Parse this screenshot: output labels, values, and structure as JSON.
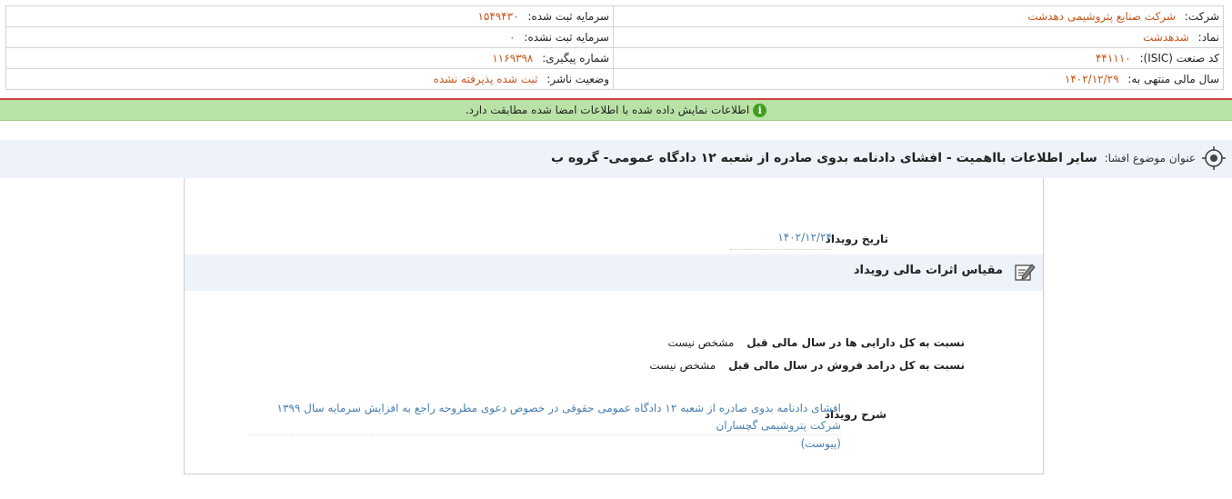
{
  "company_info": {
    "company_label": "شرکت:",
    "company_value": "شرکت صنایع پتروشیمی دهدشت",
    "registered_capital_label": "سرمایه ثبت شده:",
    "registered_capital_value": "۱۵۴۹۴۳۰",
    "symbol_label": "نماد:",
    "symbol_value": "شدهدشت",
    "unregistered_capital_label": "سرمایه ثبت نشده:",
    "unregistered_capital_value": "۰",
    "isic_label": "کد صنعت (ISIC):",
    "isic_value": "۴۴۱۱۱۰",
    "tracking_label": "شماره پیگیری:",
    "tracking_value": "۱۱۶۹۳۹۸",
    "fiscal_year_label": "سال مالی منتهی به:",
    "fiscal_year_value": "۱۴۰۲/۱۲/۲۹",
    "publisher_status_label": "وضعیت ناشر:",
    "publisher_status_value": "ثبت شده پذیرفته نشده"
  },
  "notice": {
    "text": "اطلاعات نمایش داده شده با اطلاعات امضا شده مطابقت دارد.",
    "icon": "info-icon",
    "color": "#b9e3a6"
  },
  "subject": {
    "label": "عنوان موضوع افشا:",
    "value": "سایر اطلاعات بااهمیت - افشای دادنامه بدوی صادره از شعبه ۱۲ دادگاه عمومی- گروه ب",
    "icon": "target-icon"
  },
  "event": {
    "date_label": "تاریخ رویداد",
    "date_value": "۱۴۰۲/۱۲/۲۴"
  },
  "financial_impact": {
    "title": "مقیاس اثرات مالی رویداد",
    "icon": "edit-icon",
    "assets_ratio_label": "نسبت به کل دارایی ها در سال مالی قبل",
    "assets_ratio_value": "مشخص نیست",
    "revenue_ratio_label": "نسبت به کل درامد فروش در سال مالی قبل",
    "revenue_ratio_value": "مشخص نیست"
  },
  "description": {
    "label": "شرح رویداد",
    "line1": "افشای دادنامه بدوی صادره از شعبه ۱۲ دادگاه عمومی حقوقی در خصوص دعوی مطروحه راجع به افزایش سرمایه سال ۱۳۹۹ شرکت پتروشیمی گچساران",
    "line2": "(پیوست)"
  },
  "colors": {
    "accent_value": "#c7561b",
    "link_value": "#4a7fb0",
    "section_bg": "#edf3f9"
  }
}
